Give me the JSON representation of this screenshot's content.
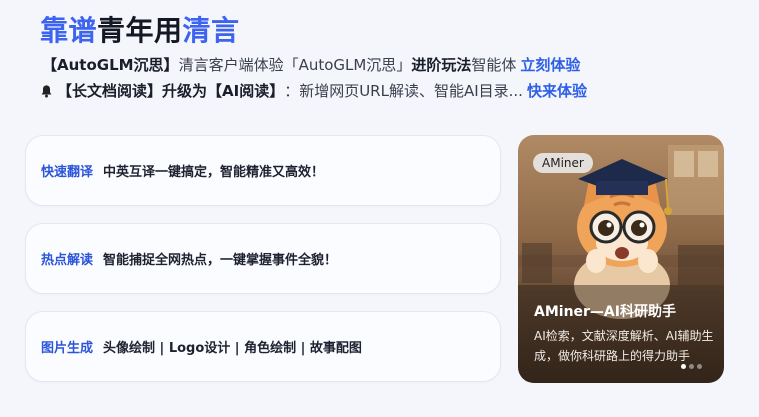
{
  "headline": {
    "part1": "靠谱",
    "part2": "青年用",
    "part3": "清言"
  },
  "notices": [
    {
      "icon": "sparkle-icon",
      "glyph": "",
      "bracket": "【AutoGLM沉思】",
      "text": "清言客户端体验「AutoGLM沉思」",
      "highlight": "进阶玩法",
      "tail": "智能体",
      "arrows": "",
      "link": "立刻体验"
    },
    {
      "icon": "bell-icon",
      "bracket": "【长文档阅读】升级为【AI阅读】",
      "text": "：新增网页URL解读、智能AI目录...",
      "arrows": "",
      "link": "快来体验"
    }
  ],
  "features": [
    {
      "tag": "快速翻译",
      "desc": "中英互译一键搞定，智能精准又高效！"
    },
    {
      "tag": "热点解读",
      "desc": "智能捕捉全网热点，一键掌握事件全貌！"
    },
    {
      "tag": "图片生成",
      "desc": "头像绘制 | Logo设计 | 角色绘制 | 故事配图"
    }
  ],
  "promo": {
    "badge": "AMiner",
    "title": "AMiner—AI科研助手",
    "desc": "AI检索，文献深度解析、AI辅助生成，做你科研路上的得力助手",
    "slides_total": 3,
    "slide_active": 1
  }
}
